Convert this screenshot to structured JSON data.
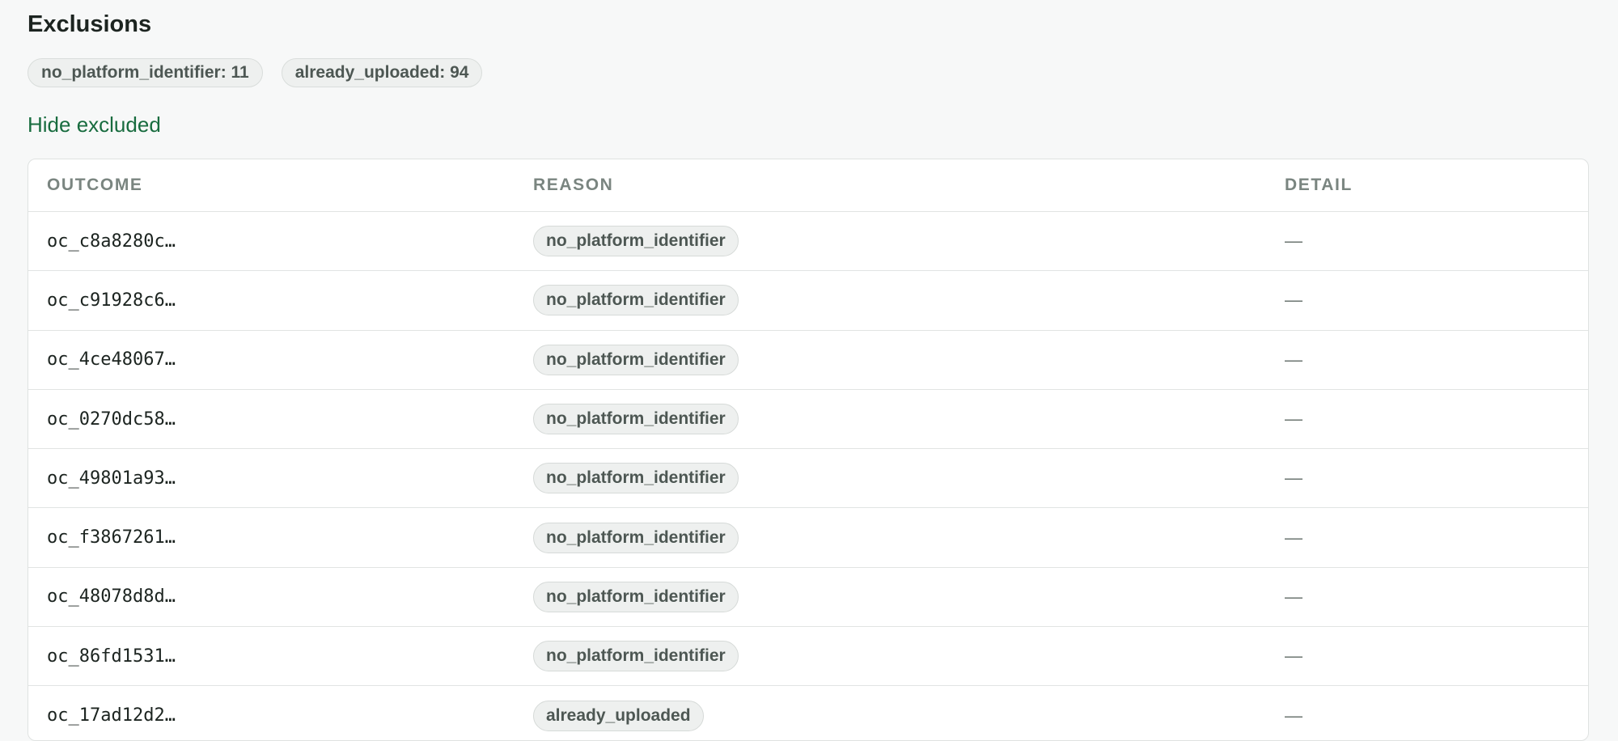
{
  "section": {
    "title": "Exclusions"
  },
  "summary_chips": [
    {
      "label": "no_platform_identifier: 11"
    },
    {
      "label": "already_uploaded: 94"
    }
  ],
  "toggle": {
    "label": "Hide excluded"
  },
  "table": {
    "headers": {
      "outcome": "OUTCOME",
      "reason": "REASON",
      "detail": "DETAIL"
    },
    "rows": [
      {
        "outcome": "oc_c8a8280c…",
        "reason": "no_platform_identifier",
        "detail": "—"
      },
      {
        "outcome": "oc_c91928c6…",
        "reason": "no_platform_identifier",
        "detail": "—"
      },
      {
        "outcome": "oc_4ce48067…",
        "reason": "no_platform_identifier",
        "detail": "—"
      },
      {
        "outcome": "oc_0270dc58…",
        "reason": "no_platform_identifier",
        "detail": "—"
      },
      {
        "outcome": "oc_49801a93…",
        "reason": "no_platform_identifier",
        "detail": "—"
      },
      {
        "outcome": "oc_f3867261…",
        "reason": "no_platform_identifier",
        "detail": "—"
      },
      {
        "outcome": "oc_48078d8d…",
        "reason": "no_platform_identifier",
        "detail": "—"
      },
      {
        "outcome": "oc_86fd1531…",
        "reason": "no_platform_identifier",
        "detail": "—"
      },
      {
        "outcome": "oc_17ad12d2…",
        "reason": "already_uploaded",
        "detail": "—"
      }
    ]
  },
  "colors": {
    "link": "#186c3f",
    "chip_bg": "#eef0ef",
    "chip_text": "#4d5753",
    "header_text": "#7a8580"
  }
}
